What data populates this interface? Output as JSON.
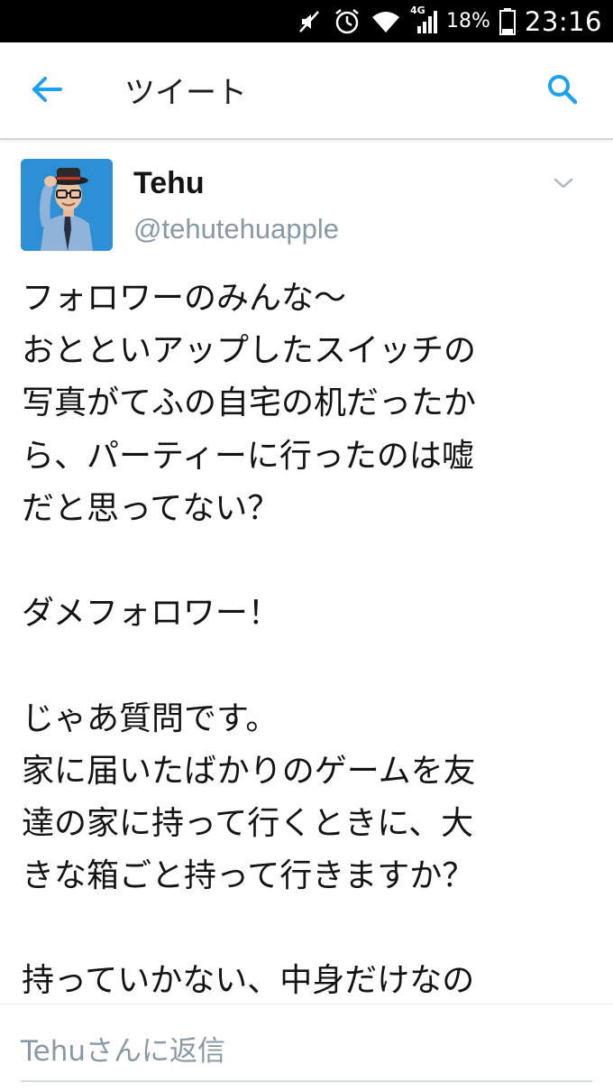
{
  "status_bar": {
    "battery_percent": "18%",
    "time": "23:16",
    "network_label": "4G",
    "icons": [
      "mute-icon",
      "alarm-icon",
      "wifi-icon",
      "signal-icon",
      "battery-icon"
    ]
  },
  "header": {
    "back_icon": "arrow-left-icon",
    "title": "ツイート",
    "search_icon": "search-icon",
    "accent_color": "#1da1f2"
  },
  "tweet": {
    "author": {
      "display_name": "Tehu",
      "screen_name": "@tehutehuapple"
    },
    "text_lines": [
      "フォロワーのみんな〜",
      "おとといアップしたスイッチの",
      "写真がてふの自宅の机だったか",
      "ら、パーティーに行ったのは嘘",
      "だと思ってない？",
      "",
      "ダメフォロワー！",
      "",
      "じゃあ質問です。",
      "家に届いたばかりのゲームを友",
      "達の家に持って行くときに、大",
      "きな箱ごと持って行きますか？",
      "",
      "持っていかない、中身だけなの"
    ]
  },
  "reply": {
    "placeholder": "Tehuさんに返信"
  }
}
